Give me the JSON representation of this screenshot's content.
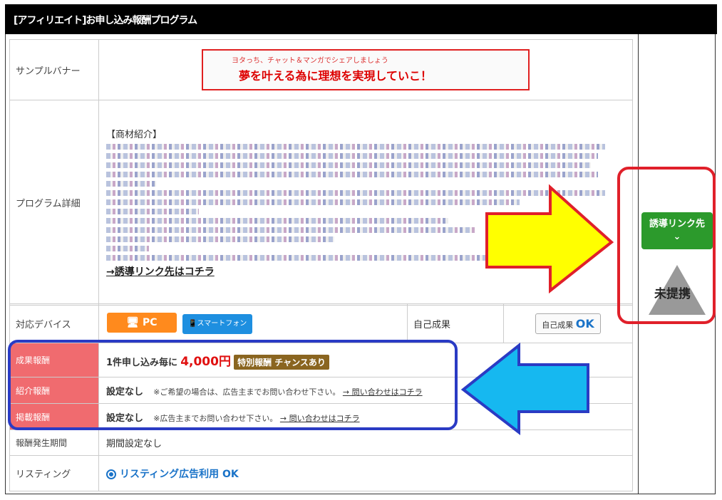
{
  "title": "[アフィリエイト]お申し込み報酬プログラム",
  "rows": {
    "banner_label": "サンプルバナー",
    "banner_text_small": "ヨタっち、チャット＆マンガでシェアしましょう",
    "banner_text_main": "夢を叶える為に理想を実現していこ！",
    "detail_label": "プログラム詳細",
    "detail_head": "【商材紹介】",
    "detail_link": "→誘導リンク先はコチラ",
    "device_label": "対応デバイス",
    "device_pc": "PC",
    "device_sp": "スマートフォン",
    "self_label": "自己成果",
    "self_ok_prefix": "自己成果",
    "self_ok": "OK",
    "reward_label": "成果報酬",
    "reward_prefix": "1件申し込み毎に",
    "reward_price": "4,000円",
    "reward_badge": "特別報酬 チャンスあり",
    "intro_label": "紹介報酬",
    "intro_value": "設定なし",
    "intro_note": "※ご希望の場合は、広告主までお問い合わせ下さい。",
    "intro_link": "→ 問い合わせはコチラ",
    "post_label": "掲載報酬",
    "post_value": "設定なし",
    "post_note": "※広告主までお問い合わせ下さい。",
    "post_link": "→ 問い合わせはコチラ",
    "period_label": "報酬発生期間",
    "period_value": "期間設定なし",
    "listing_label": "リスティング",
    "listing_value": "リスティング広告利用 OK"
  },
  "side": {
    "button_label": "誘導リンク先",
    "button_chevron": "⌄",
    "status": "未提携"
  },
  "colors": {
    "red_frame": "#e0202a",
    "blue_frame": "#2a3bc4",
    "yellow_arrow": "#ffff00",
    "blue_arrow": "#16b8f0"
  }
}
